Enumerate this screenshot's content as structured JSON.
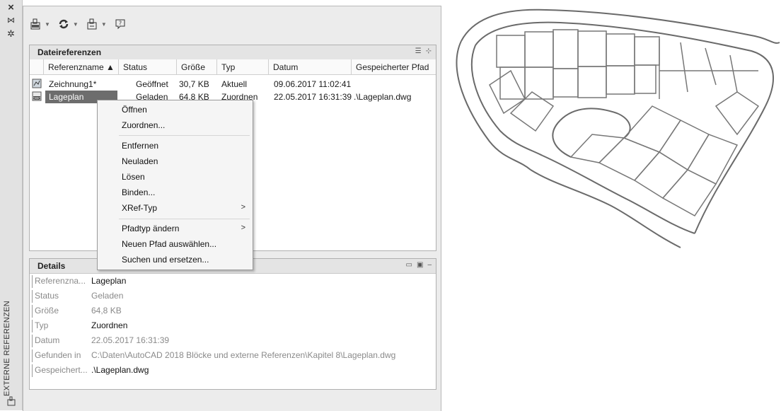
{
  "strip": {
    "close_glyph": "×",
    "pin_glyph": "⋈",
    "settings_glyph": "✲",
    "title": "EXTERNE REFERENZEN",
    "bottom_icon": "attach-icon"
  },
  "toolbar": {
    "buttons": [
      {
        "icon": "attach-dwg-icon",
        "has_dropdown": true
      },
      {
        "icon": "refresh-icon",
        "has_dropdown": true
      },
      {
        "icon": "change-path-icon",
        "has_dropdown": true
      },
      {
        "icon": "help-icon",
        "has_dropdown": false
      }
    ]
  },
  "file_refs": {
    "title": "Dateireferenzen",
    "columns": [
      "Referenzname ▲",
      "Status",
      "Größe",
      "Typ",
      "Datum",
      "Gespeicherter Pfad"
    ],
    "rows": [
      {
        "name": "Zeichnung1*",
        "status": "Geöffnet",
        "size": "30,7 KB",
        "type": "Aktuell",
        "date": "09.06.2017 11:02:41",
        "path": "",
        "icon": "drawing-icon",
        "selected": false
      },
      {
        "name": "Lageplan",
        "status": "Geladen",
        "size": "64,8 KB",
        "type": "Zuordnen",
        "date": "22.05.2017 16:31:39",
        "path": ".\\Lageplan.dwg",
        "icon": "dwg-icon",
        "selected": true
      }
    ]
  },
  "context_menu": {
    "items": [
      {
        "label": "Öffnen"
      },
      {
        "label": "Zuordnen..."
      },
      {
        "label": "Entfernen"
      },
      {
        "label": "Neuladen"
      },
      {
        "label": "Lösen"
      },
      {
        "label": "Binden..."
      },
      {
        "label": "XRef-Typ",
        "submenu": ">"
      },
      {
        "label": "Pfadtyp ändern",
        "submenu": ">"
      },
      {
        "label": "Neuen Pfad auswählen..."
      },
      {
        "label": "Suchen und ersetzen..."
      }
    ]
  },
  "details": {
    "title": "Details",
    "collapse_glyph": "–",
    "fields": [
      {
        "label": "Referenzna...",
        "value": "Lageplan",
        "emph": true
      },
      {
        "label": "Status",
        "value": "Geladen",
        "emph": false
      },
      {
        "label": "Größe",
        "value": "64,8 KB",
        "emph": false
      },
      {
        "label": "Typ",
        "value": "Zuordnen",
        "emph": true
      },
      {
        "label": "Datum",
        "value": "22.05.2017 16:31:39",
        "emph": false
      },
      {
        "label": "Gefunden in",
        "value": "C:\\Daten\\AutoCAD 2018 Blöcke und externe Referenzen\\Kapitel 8\\Lageplan.dwg",
        "emph": false
      },
      {
        "label": "Gespeichert...",
        "value": ".\\Lageplan.dwg",
        "emph": true
      }
    ]
  },
  "colors": {
    "selection": "#6d6d6d",
    "panel_bg": "#ececec",
    "muted_text": "#8a8a8a"
  }
}
